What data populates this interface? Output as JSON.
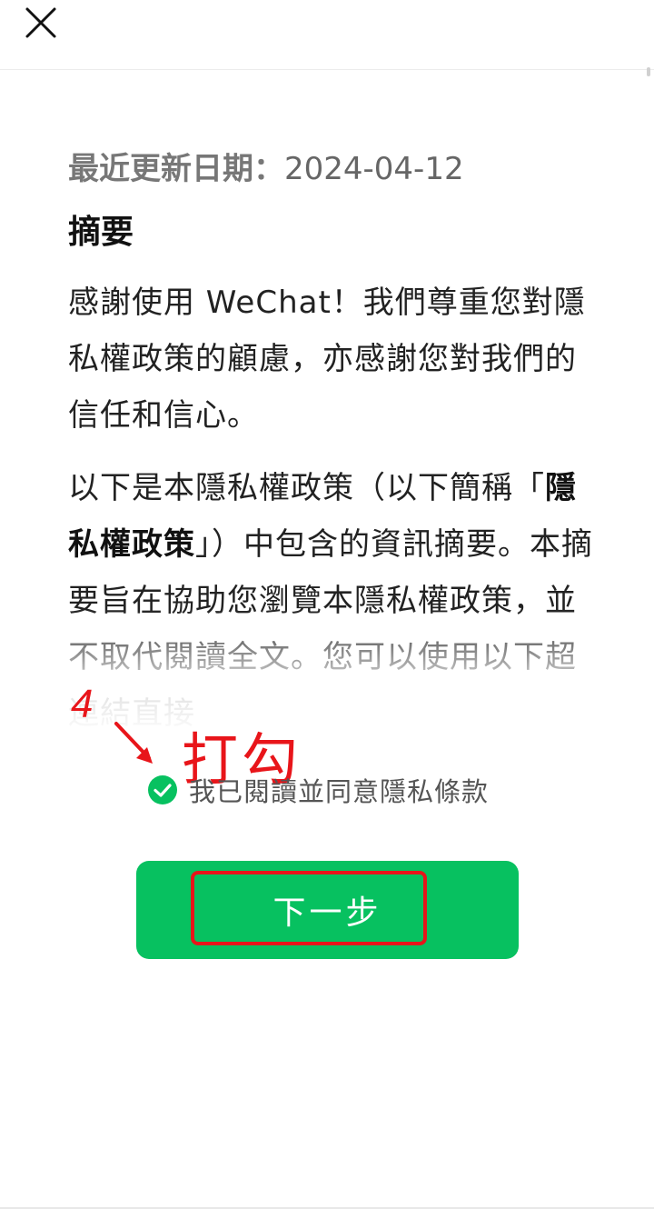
{
  "header": {
    "close_icon": "close-icon"
  },
  "policy": {
    "updated_label": "最近更新日期：",
    "updated_date": "2024-04-12",
    "summary_title": "摘要",
    "para1": "感謝使用 WeChat！我們尊重您對隱私權政策的顧慮，亦感謝您對我們的信任和信心。",
    "para2_prefix": "以下是本隱私權政策（以下簡稱「",
    "para2_bold": "隱私權政策",
    "para2_suffix": "」）中包含的資訊摘要。本摘要旨在協助您瀏覽本隱私權政策，並不取代閱讀全",
    "para2_tail": "文。您可以使用以下超連結直接"
  },
  "annotation": {
    "step_number": "4",
    "instruction": "打勾",
    "color": "#e8151a"
  },
  "agreement": {
    "checked": true,
    "label": "我已閱讀並同意隱私條款",
    "check_color": "#07c160"
  },
  "actions": {
    "next_label": "下一步",
    "button_color": "#07c160"
  }
}
